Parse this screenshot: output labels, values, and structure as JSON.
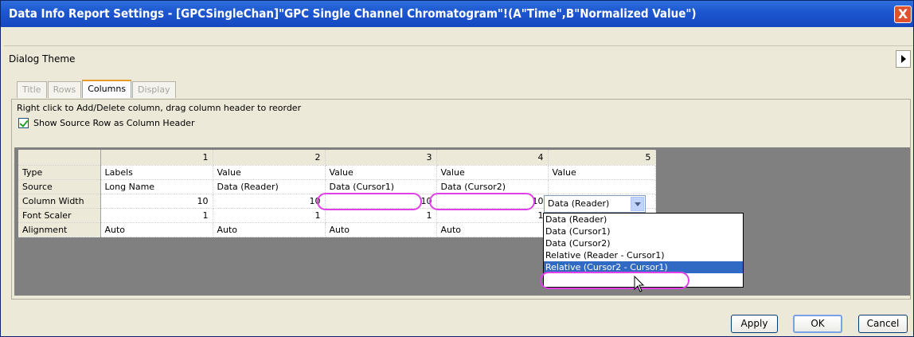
{
  "window": {
    "title": "Data Info Report Settings - [GPCSingleChan]\"GPC Single Channel Chromatogram\"!(A\"Time\",B\"Normalized Value\")",
    "close": "X"
  },
  "theme": {
    "label": "Dialog Theme"
  },
  "tabs": [
    {
      "label": "Title"
    },
    {
      "label": "Rows"
    },
    {
      "label": "Columns"
    },
    {
      "label": "Display"
    }
  ],
  "instruction": "Right click to Add/Delete column, drag column header to reorder",
  "show_source_checkbox": {
    "label": "Show Source Row as Column Header",
    "checked": true
  },
  "grid": {
    "col_headers": [
      "1",
      "2",
      "3",
      "4",
      "5"
    ],
    "rows": [
      {
        "label": "Type",
        "cells": [
          "Labels",
          "Value",
          "Value",
          "Value",
          "Value"
        ]
      },
      {
        "label": "Source",
        "cells": [
          "Long Name",
          "Data (Reader)",
          "Data (Cursor1)",
          "Data (Cursor2)",
          "Data (Reader)"
        ]
      },
      {
        "label": "Column Width",
        "cells": [
          "10",
          "10",
          "10",
          "10",
          ""
        ]
      },
      {
        "label": "Font Scaler",
        "cells": [
          "1",
          "1",
          "1",
          "1",
          ""
        ]
      },
      {
        "label": "Alignment",
        "cells": [
          "Auto",
          "Auto",
          "Auto",
          "Auto",
          ""
        ]
      }
    ]
  },
  "source_dropdown": {
    "selected": "Data (Reader)",
    "options": [
      "Data (Reader)",
      "Data (Cursor1)",
      "Data (Cursor2)",
      "Relative (Reader - Cursor1)",
      "Relative (Cursor2 - Cursor1)"
    ],
    "highlighted_index": 4
  },
  "buttons": {
    "apply": "Apply",
    "ok": "OK",
    "cancel": "Cancel"
  },
  "colors": {
    "titlebar": "#1d57d0",
    "annotation_oval": "#e040e8",
    "highlight": "#316ac5"
  }
}
